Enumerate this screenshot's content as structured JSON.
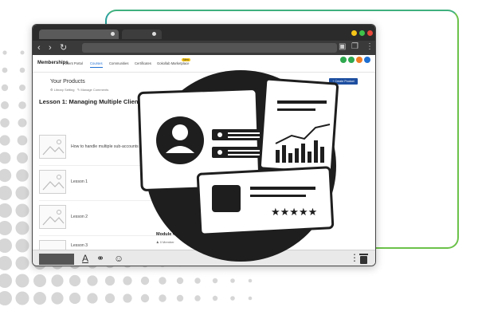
{
  "nav": {
    "brand": "Memberships",
    "items": [
      "Client Portal",
      "Courses",
      "Communities",
      "Certificates",
      "Gokollab Marketplace"
    ],
    "active_index": 1,
    "new_badge": "New"
  },
  "products": {
    "title": "Your Products",
    "library_link": "Library Setting",
    "manage_link": "Manage Comments",
    "create_button": "+ Create Product"
  },
  "lesson": {
    "heading": "Lesson 1: Managing Multiple Clients or Locations",
    "rows": [
      {
        "label": "How to handle multiple sub-accounts eff"
      },
      {
        "label": "Lesson 1"
      },
      {
        "label": "Lesson 2"
      },
      {
        "label": "Lesson 3"
      }
    ]
  },
  "module": {
    "title": "Module 4: I",
    "members": "0 Member"
  },
  "colors": {
    "accent": "#1f6fd1",
    "create_button": "#1e4fa0",
    "frame_green": "#6cc24a",
    "frame_teal": "#2aa19c",
    "hero_dark": "#1e1e1e"
  },
  "icons": [
    "back-icon",
    "forward-icon",
    "reload-icon",
    "lock-icon",
    "copy-icon",
    "menu-icon",
    "text-format-icon",
    "link-icon",
    "emoji-icon",
    "trash-icon",
    "user-icon",
    "location-icon",
    "phone-icon",
    "star-icon"
  ]
}
